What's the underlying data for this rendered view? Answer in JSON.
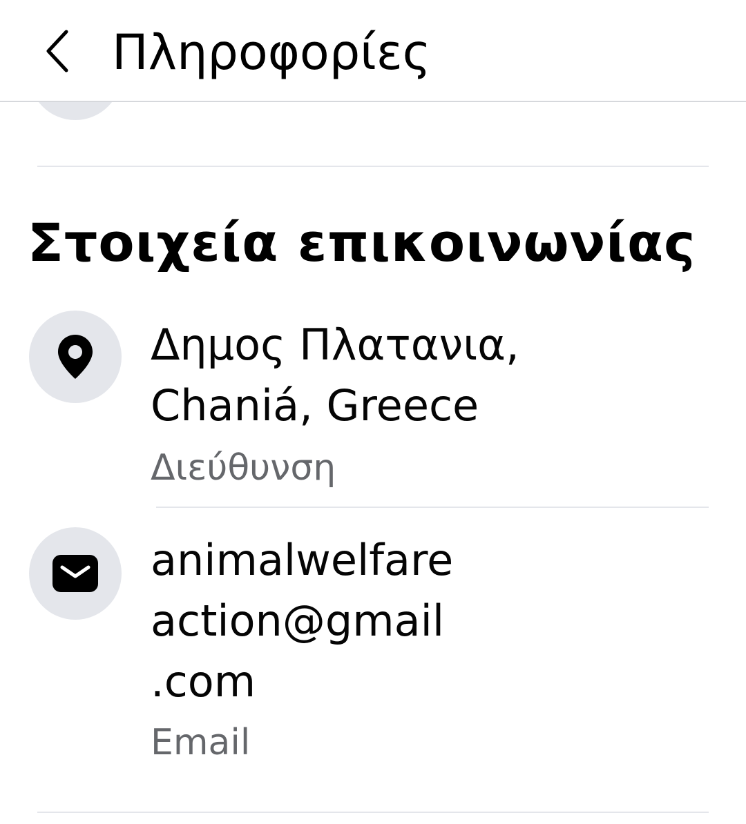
{
  "header": {
    "back_icon": "chevron-left-icon",
    "title": "Πληροφορίες"
  },
  "section": {
    "title": "Στοιχεία επικοινωνίας"
  },
  "contacts": [
    {
      "icon": "location-pin-icon",
      "value": "Δημος Πλατανια,\nChaniá, Greece",
      "label": "Διεύθυνση"
    },
    {
      "icon": "envelope-icon",
      "value": "animalwelfare\naction@gmail\n.com",
      "label": "Email"
    }
  ],
  "colors": {
    "icon_circle_bg": "#e4e6eb",
    "secondary_text": "#65676b",
    "divider": "#e4e6eb"
  }
}
